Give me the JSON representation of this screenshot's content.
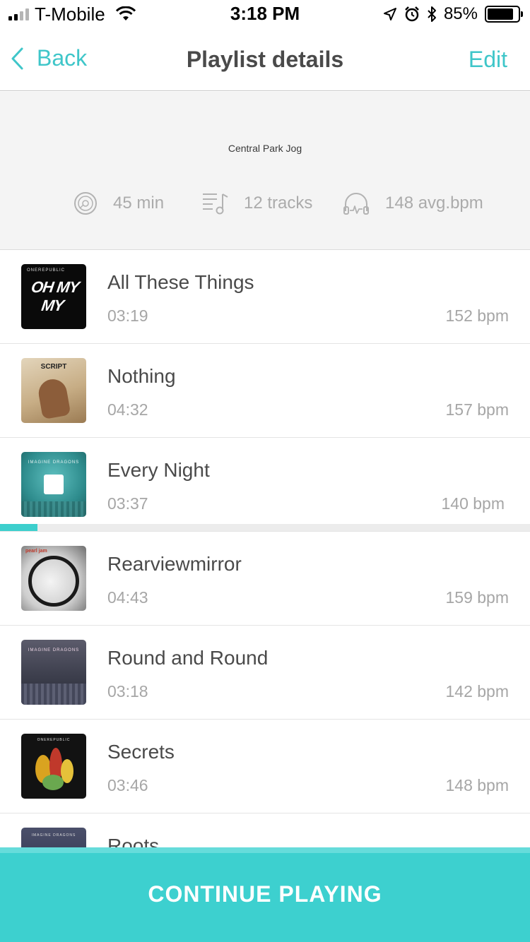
{
  "status_bar": {
    "carrier": "T-Mobile",
    "time": "3:18 PM",
    "battery_percent": "85%",
    "battery_level": 0.85,
    "signal_bars_filled": 2,
    "signal_bars_total": 4,
    "icons": [
      "signal-icon",
      "wifi-icon",
      "location-icon",
      "alarm-icon",
      "bluetooth-icon",
      "battery-icon"
    ]
  },
  "nav": {
    "back_label": "Back",
    "title": "Playlist details",
    "edit_label": "Edit",
    "accent_color": "#3fc6c9"
  },
  "playlist": {
    "name": "Central Park Jog",
    "duration": "45 min",
    "tracks": "12 tracks",
    "avg_bpm": "148 avg.bpm",
    "icons": [
      "disc-icon",
      "tracklist-icon",
      "heartbeat-headphones-icon"
    ]
  },
  "tracks": [
    {
      "title": "All These Things",
      "duration": "03:19",
      "bpm": "152 bpm",
      "art_text": "OH MY MY",
      "art_band": "ONEREPUBLIC"
    },
    {
      "title": "Nothing",
      "duration": "04:32",
      "bpm": "157 bpm",
      "art_text": "SCRIPT"
    },
    {
      "title": "Every Night",
      "duration": "03:37",
      "bpm": "140 bpm",
      "art_text": "IMAGINE DRAGONS",
      "playing": true,
      "progress": 0.07
    },
    {
      "title": "Rearviewmirror",
      "duration": "04:43",
      "bpm": "159 bpm",
      "art_text": "pearl jam"
    },
    {
      "title": "Round and Round",
      "duration": "03:18",
      "bpm": "142 bpm",
      "art_text": "IMAGINE DRAGONS"
    },
    {
      "title": "Secrets",
      "duration": "03:46",
      "bpm": "148 bpm",
      "art_text": "ONEREPUBLIC"
    },
    {
      "title": "Roots",
      "art_text": "IMAGINE DRAGONS"
    }
  ],
  "continue_button": {
    "label": "CONTINUE PLAYING",
    "color": "#3dd0cf"
  }
}
